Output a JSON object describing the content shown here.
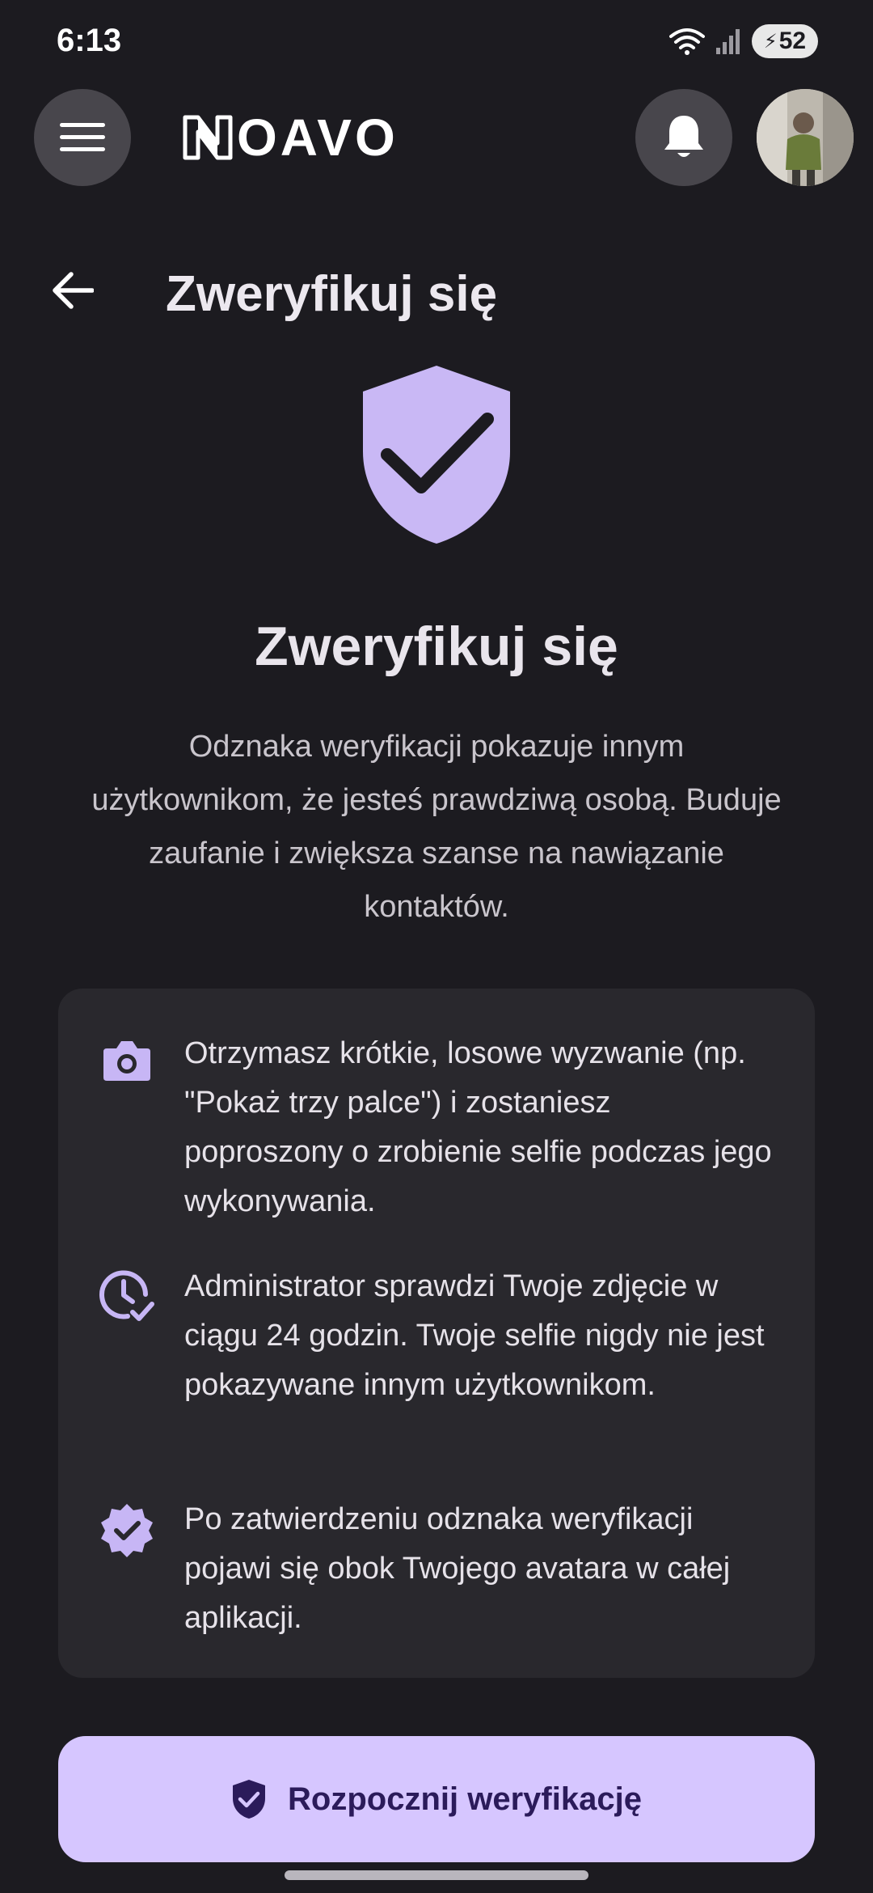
{
  "status_bar": {
    "time": "6:13",
    "battery_level": "52",
    "icons": [
      "wifi-icon",
      "signal-icon",
      "battery-charging-icon"
    ]
  },
  "app_bar": {
    "logo_text": "OAVO",
    "icons": [
      "menu-icon",
      "noavo-logo-icon",
      "bell-icon",
      "avatar"
    ]
  },
  "page": {
    "title": "Zweryfikuj się"
  },
  "hero": {
    "title": "Zweryfikuj się",
    "description": "Odznaka weryfikacji pokazuje innym użytkownikom, że jesteś prawdziwą osobą. Buduje zaufanie i zwiększa szanse na nawiązanie kontaktów.",
    "icon": "shield-check-icon"
  },
  "info_card": {
    "items": [
      {
        "icon": "camera-icon",
        "text": "Otrzymasz krótkie, losowe wyzwanie (np. \"Pokaż trzy palce\") i zostaniesz poproszony o zrobienie selfie podczas jego wykonywania."
      },
      {
        "icon": "clock-check-icon",
        "text": "Administrator sprawdzi Twoje zdjęcie w ciągu 24 godzin. Twoje selfie nigdy nie jest pokazywane innym użytkownikom."
      },
      {
        "icon": "verified-badge-icon",
        "text": "Po zatwierdzeniu odznaka weryfikacji pojawi się obok Twojego avatara w całej aplikacji."
      }
    ]
  },
  "actions": {
    "start_label": "Rozpocznij weryfikację",
    "start_icon": "shield-check-icon"
  },
  "colors": {
    "background": "#1c1b20",
    "card": "#29282d",
    "accent": "#d6c6ff",
    "accent_icon": "#c7b6f5",
    "button_text": "#2b1b5a"
  }
}
